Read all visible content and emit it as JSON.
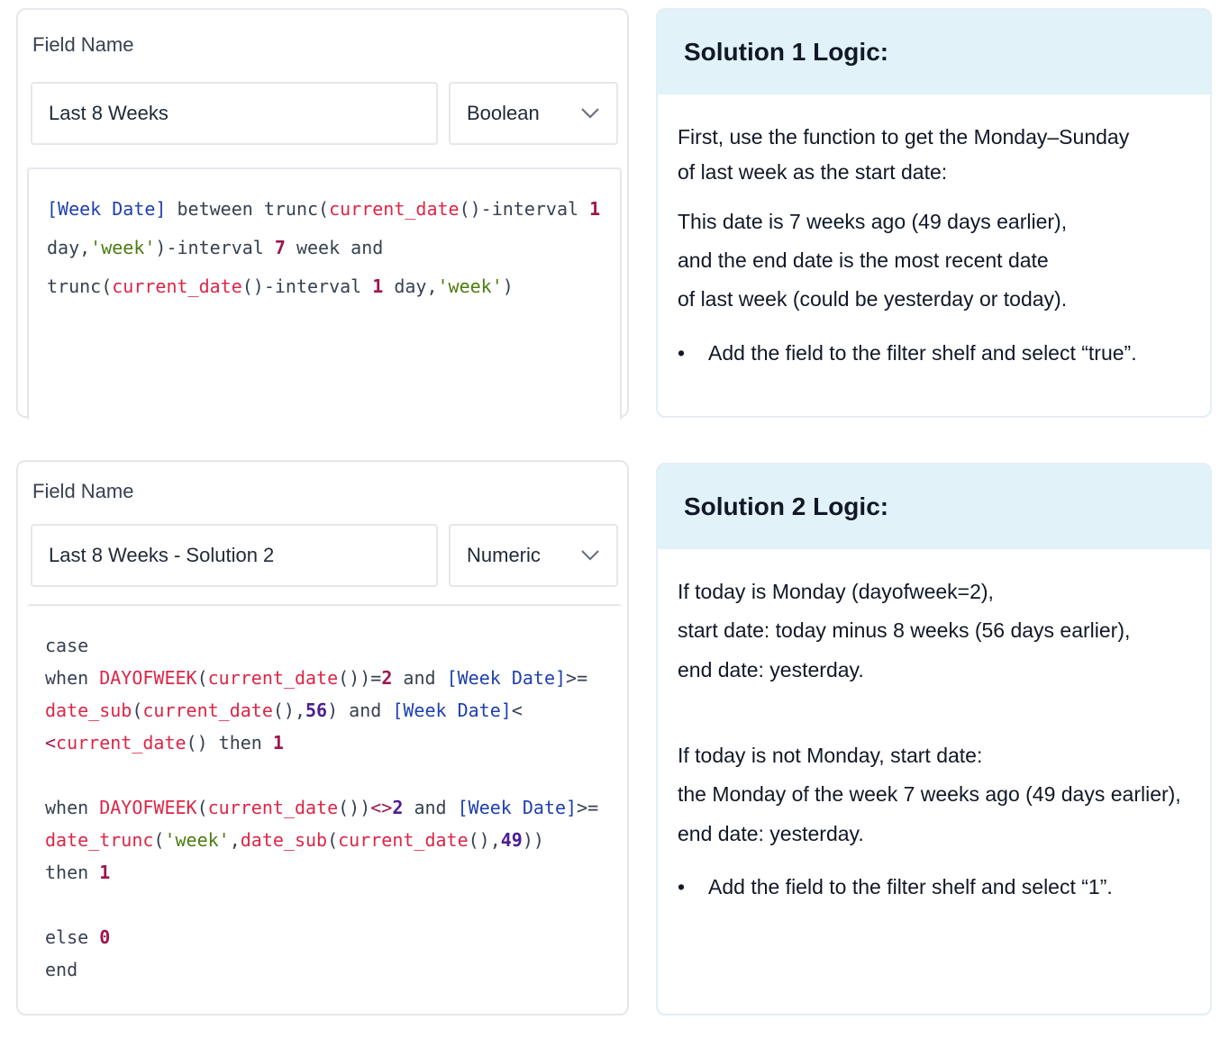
{
  "solution1": {
    "field_label": "Field Name",
    "name_value": "Last 8 Weeks",
    "type_value": "Boolean",
    "code_lines": [
      [
        [
          "field",
          "[Week Date]"
        ],
        [
          "txt",
          " between trunc("
        ],
        [
          "func",
          "current_date"
        ],
        [
          "txt",
          "()-interval "
        ],
        [
          "num",
          "1"
        ]
      ],
      [
        [
          "txt",
          "day,"
        ],
        [
          "str",
          "'week'"
        ],
        [
          "txt",
          ")-interval "
        ],
        [
          "num",
          "7"
        ],
        [
          "txt",
          " week and"
        ]
      ],
      [
        [
          "txt",
          "trunc("
        ],
        [
          "func",
          "current_date"
        ],
        [
          "txt",
          "()-interval "
        ],
        [
          "num",
          "1"
        ],
        [
          "txt",
          " day,"
        ],
        [
          "str",
          "'week'"
        ],
        [
          "txt",
          ")"
        ]
      ]
    ],
    "logic_title": "Solution 1 Logic:",
    "logic_lines": [
      "First, use the function to get the Monday–Sunday",
      "of last week as the start date:",
      "This date is 7 weeks ago (49 days earlier),",
      "and the end date is the most recent date",
      "of last week (could be yesterday or today)."
    ],
    "bullet": "Add the field to the filter shelf and select “true”."
  },
  "solution2": {
    "field_label": "Field Name",
    "name_value": "Last 8 Weeks - Solution 2",
    "type_value": "Numeric",
    "code_lines": [
      [
        [
          "txt",
          "case"
        ]
      ],
      [
        [
          "txt",
          "when "
        ],
        [
          "func",
          "DAYOFWEEK"
        ],
        [
          "txt",
          "("
        ],
        [
          "func",
          "current_date"
        ],
        [
          "txt",
          "())="
        ],
        [
          "num",
          "2"
        ],
        [
          "txt",
          " and "
        ],
        [
          "field",
          "[Week Date]"
        ],
        [
          "txt",
          ">="
        ]
      ],
      [
        [
          "func",
          "date_sub"
        ],
        [
          "txt",
          "("
        ],
        [
          "func",
          "current_date"
        ],
        [
          "txt",
          "(),"
        ],
        [
          "num2",
          "56"
        ],
        [
          "txt",
          ") and "
        ],
        [
          "field",
          "[Week Date]"
        ],
        [
          "txt",
          "<"
        ]
      ],
      [
        [
          "op",
          "<"
        ],
        [
          "func",
          "current_date"
        ],
        [
          "txt",
          "() then "
        ],
        [
          "num",
          "1"
        ]
      ],
      [],
      [
        [
          "txt",
          "when "
        ],
        [
          "func",
          "DAYOFWEEK"
        ],
        [
          "txt",
          "("
        ],
        [
          "func",
          "current_date"
        ],
        [
          "txt",
          "())"
        ],
        [
          "op",
          "<>"
        ],
        [
          "num2",
          "2"
        ],
        [
          "txt",
          " and "
        ],
        [
          "field",
          "[Week Date]"
        ],
        [
          "txt",
          ">="
        ]
      ],
      [
        [
          "func",
          "date_trunc"
        ],
        [
          "txt",
          "("
        ],
        [
          "str",
          "'week'"
        ],
        [
          "txt",
          ","
        ],
        [
          "func",
          "date_sub"
        ],
        [
          "txt",
          "("
        ],
        [
          "func",
          "current_date"
        ],
        [
          "txt",
          "(),"
        ],
        [
          "num2",
          "49"
        ],
        [
          "txt",
          "))"
        ]
      ],
      [
        [
          "txt",
          "then "
        ],
        [
          "num",
          "1"
        ]
      ],
      [],
      [
        [
          "txt",
          "else "
        ],
        [
          "num",
          "0"
        ]
      ],
      [
        [
          "txt",
          "end"
        ]
      ]
    ],
    "logic_title": "Solution 2 Logic:",
    "logic_lines": [
      "If today is Monday (dayofweek=2),",
      "start date: today minus 8 weeks (56 days earlier),",
      "end date: yesterday.",
      "If today is not Monday, start date:",
      "the Monday of the week 7 weeks ago (49 days earlier),",
      "end date: yesterday."
    ],
    "bullet": "Add the field to the filter shelf and select “1”."
  },
  "icons": {
    "dropdown": "chevron-down-icon"
  },
  "colors": {
    "field_ref": "#1e40af",
    "function": "#dc2647",
    "number": "#9d174d",
    "string": "#4d7c0f",
    "logic_header_bg": "#e1f2f9"
  }
}
